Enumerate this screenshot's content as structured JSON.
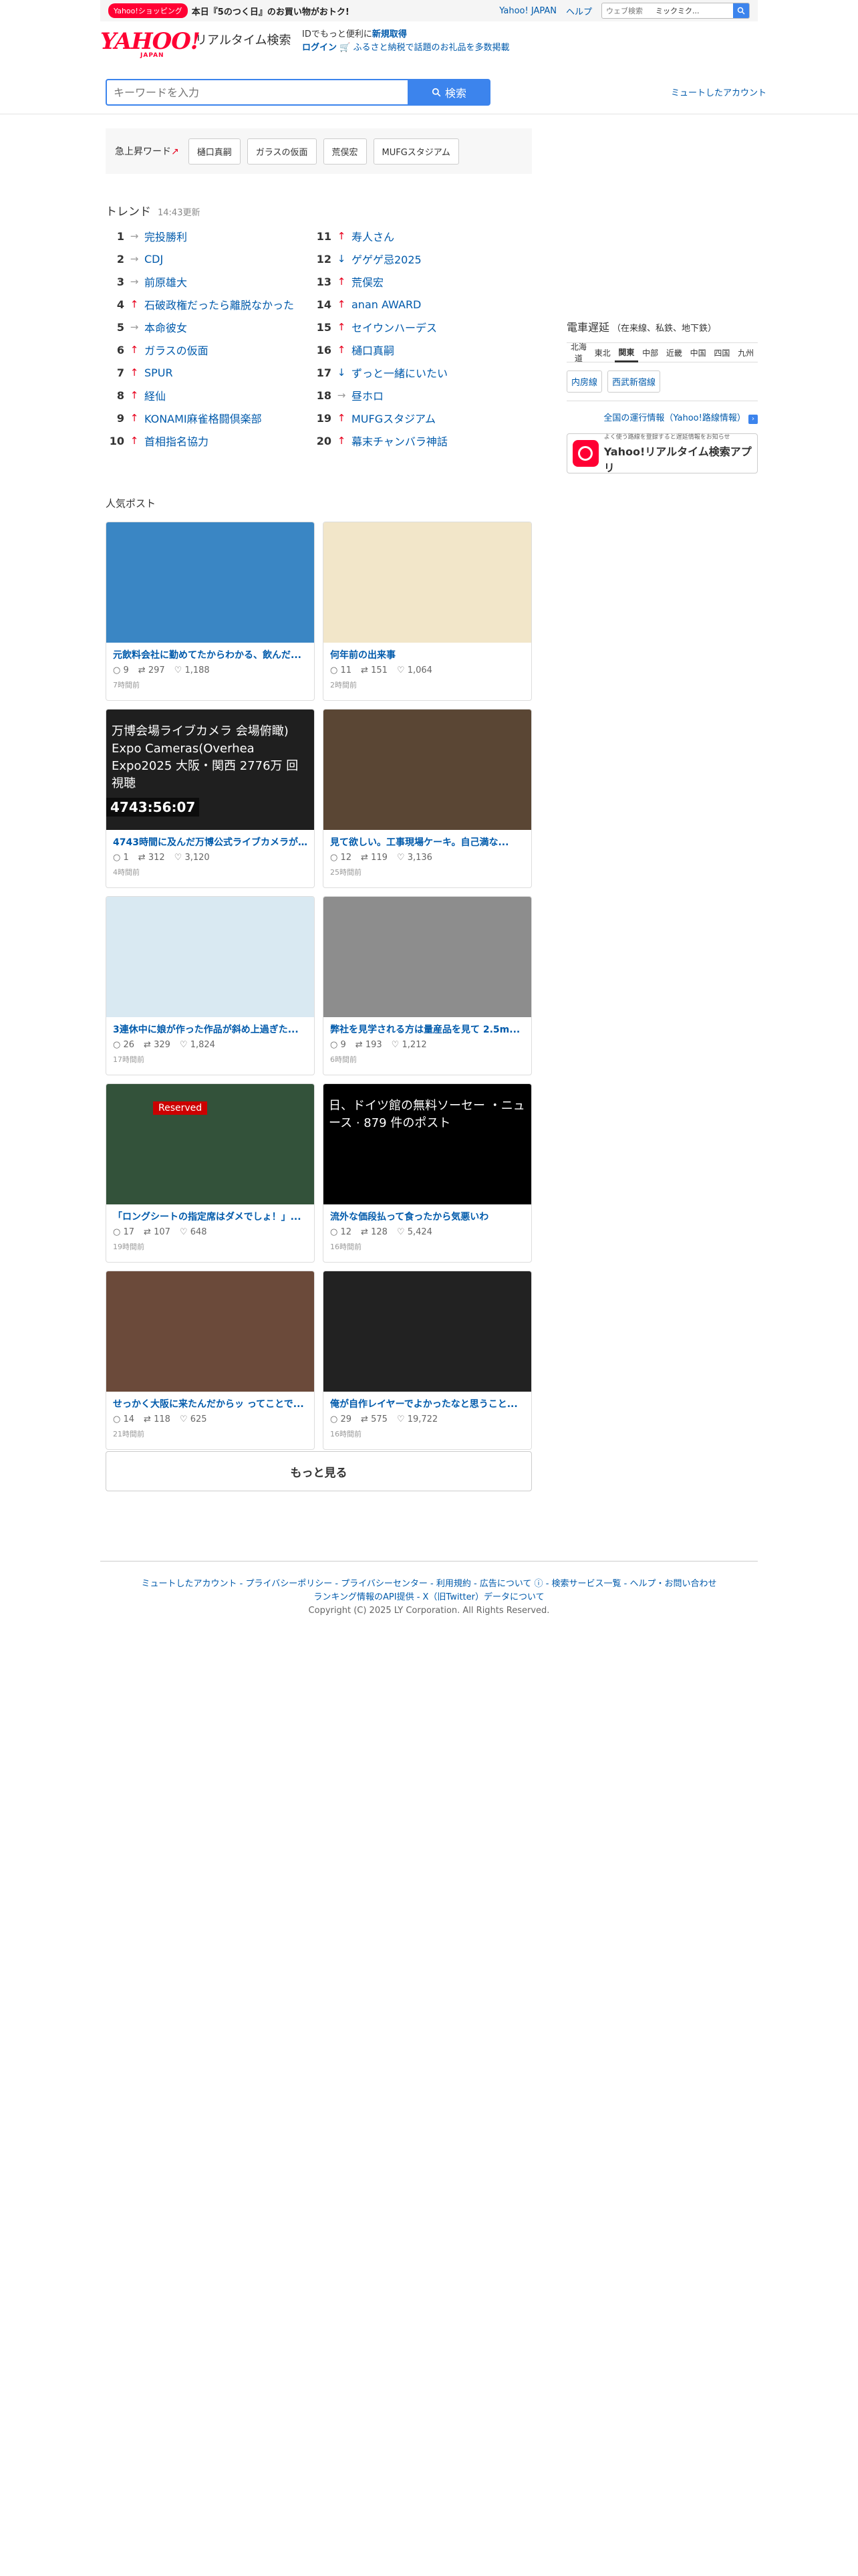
{
  "topbar": {
    "badge": "Yahoo!ショッピング",
    "promo": "本日『5のつく日』のお買い物がおトク!",
    "links": [
      "Yahoo! JAPAN",
      "ヘルプ"
    ],
    "websearch_placeholder": "ウェブ検索",
    "websearch_suggest": "ミックミク..."
  },
  "header": {
    "logo": "YAHOO!",
    "logo_sub": "JAPAN",
    "title": "リアルタイム検索",
    "msg1_a": "IDでもっと便利に",
    "msg1_b": "新規取得",
    "login": "ログイン",
    "msg2": "🛒 ふるさと納税で話題のお礼品を多数掲載"
  },
  "search": {
    "placeholder": "キーワードを入力",
    "button": "検索"
  },
  "muted_accounts": "ミュートしたアカウント",
  "rising": {
    "label": "急上昇ワード",
    "chips": [
      "樋口真嗣",
      "ガラスの仮面",
      "荒俣宏",
      "MUFGスタジアム"
    ]
  },
  "trend": {
    "title": "トレンド",
    "updated": "14:43更新",
    "left": [
      {
        "rank": "1",
        "arrow": "→",
        "dir": "flat",
        "word": "完投勝利"
      },
      {
        "rank": "2",
        "arrow": "→",
        "dir": "flat",
        "word": "CDJ"
      },
      {
        "rank": "3",
        "arrow": "→",
        "dir": "flat",
        "word": "前原雄大"
      },
      {
        "rank": "4",
        "arrow": "↑",
        "dir": "up",
        "word": "石破政権だったら離脱なかった"
      },
      {
        "rank": "5",
        "arrow": "→",
        "dir": "flat",
        "word": "本命彼女"
      },
      {
        "rank": "6",
        "arrow": "↑",
        "dir": "up",
        "word": "ガラスの仮面"
      },
      {
        "rank": "7",
        "arrow": "↑",
        "dir": "up",
        "word": "SPUR"
      },
      {
        "rank": "8",
        "arrow": "↑",
        "dir": "up",
        "word": "経仙"
      },
      {
        "rank": "9",
        "arrow": "↑",
        "dir": "up",
        "word": "KONAMI麻雀格闘倶楽部"
      },
      {
        "rank": "10",
        "arrow": "↑",
        "dir": "up",
        "word": "首相指名協力"
      }
    ],
    "right": [
      {
        "rank": "11",
        "arrow": "↑",
        "dir": "up",
        "word": "寿人さん"
      },
      {
        "rank": "12",
        "arrow": "↓",
        "dir": "down",
        "word": "ゲゲゲ忌2025"
      },
      {
        "rank": "13",
        "arrow": "↑",
        "dir": "up",
        "word": "荒俣宏"
      },
      {
        "rank": "14",
        "arrow": "↑",
        "dir": "up",
        "word": "anan AWARD"
      },
      {
        "rank": "15",
        "arrow": "↑",
        "dir": "up",
        "word": "セイウンハーデス"
      },
      {
        "rank": "16",
        "arrow": "↑",
        "dir": "up",
        "word": "樋口真嗣"
      },
      {
        "rank": "17",
        "arrow": "↓",
        "dir": "down",
        "word": "ずっと一緒にいたい"
      },
      {
        "rank": "18",
        "arrow": "→",
        "dir": "flat",
        "word": "昼ホロ"
      },
      {
        "rank": "19",
        "arrow": "↑",
        "dir": "up",
        "word": "MUFGスタジアム"
      },
      {
        "rank": "20",
        "arrow": "↑",
        "dir": "up",
        "word": "幕末チャンバラ神話"
      }
    ]
  },
  "popular": {
    "title": "人気ポスト",
    "posts": [
      {
        "title": "元飲料会社に勤めてたからわかる、飲んだ...",
        "replies": "9",
        "reposts": "297",
        "likes": "1,188",
        "time": "7時間前",
        "img_text": "",
        "bg": "#3a86c4"
      },
      {
        "title": "何年前の出来事",
        "replies": "11",
        "reposts": "151",
        "likes": "1,064",
        "time": "2時間前",
        "img_text": "",
        "bg": "#f2e6c9"
      },
      {
        "title": "4743時間に及んだ万博公式ライブカメラが...",
        "replies": "1",
        "reposts": "312",
        "likes": "3,120",
        "time": "4時間前",
        "img_text": "万博会場ライブカメラ 会場俯瞰) Expo Cameras(Overhea Expo2025 大阪・関西 2776万 回視聴",
        "badge": "4743:56:07",
        "bg": "#1f1f1f"
      },
      {
        "title": "見て欲しい。工事現場ケーキ。自己満な...",
        "replies": "12",
        "reposts": "119",
        "likes": "3,136",
        "time": "25時間前",
        "img_text": "",
        "bg": "#5a4634"
      },
      {
        "title": "3連休中に娘が作った作品が斜め上過ぎた...",
        "replies": "26",
        "reposts": "329",
        "likes": "1,824",
        "time": "17時間前",
        "img_text": "",
        "bg": "#d9e9f2"
      },
      {
        "title": "弊社を見学される方は量産品を見て 2.5m...",
        "replies": "9",
        "reposts": "193",
        "likes": "1,212",
        "time": "6時間前",
        "img_text": "",
        "bg": "#8d8d8d"
      },
      {
        "title": "「ロングシートの指定席はダメでしょ！」...",
        "replies": "17",
        "reposts": "107",
        "likes": "648",
        "time": "19時間前",
        "img_text": "Reserved",
        "bg": "#33523a"
      },
      {
        "title": "流外な価段払って食ったから気悪いわ",
        "replies": "12",
        "reposts": "128",
        "likes": "5,424",
        "time": "16時間前",
        "img_text": "日、ドイツ館の無料ソーセー ・ニュース · 879 件のポスト",
        "bg": "#000000"
      },
      {
        "title": "せっかく大阪に来たんだからッ ってことで...",
        "replies": "14",
        "reposts": "118",
        "likes": "625",
        "time": "21時間前",
        "img_text": "",
        "bg": "#6b4a3a"
      },
      {
        "title": "俺が自作レイヤーでよかったなと思うこと...",
        "replies": "29",
        "reposts": "575",
        "likes": "19,722",
        "time": "16時間前",
        "img_text": "",
        "bg": "#222222"
      }
    ],
    "more": "もっと見る"
  },
  "train": {
    "title": "電車遅延",
    "sub": "（在来線、私鉄、地下鉄）",
    "regions": [
      "北海道",
      "東北",
      "関東",
      "中部",
      "近畿",
      "中国",
      "四国",
      "九州"
    ],
    "selected_region": "関東",
    "lines": [
      "内房線",
      "西武新宿線"
    ],
    "all_link": "全国の運行情報（Yahoo!路線情報）"
  },
  "app": {
    "line1": "よく使う路線を登録すると遅延情報をお知らせ",
    "line2": "Yahoo!リアルタイム検索アプリ"
  },
  "footer": {
    "line1": "ミュートしたアカウント - プライバシーポリシー - プライバシーセンター - 利用規約 - 広告について ⓘ - 検索サービス一覧 - ヘルプ・お問い合わせ",
    "line2": "ランキング情報のAPI提供 - X（旧Twitter）データについて",
    "copy": "Copyright (C) 2025 LY Corporation. All Rights Reserved."
  }
}
